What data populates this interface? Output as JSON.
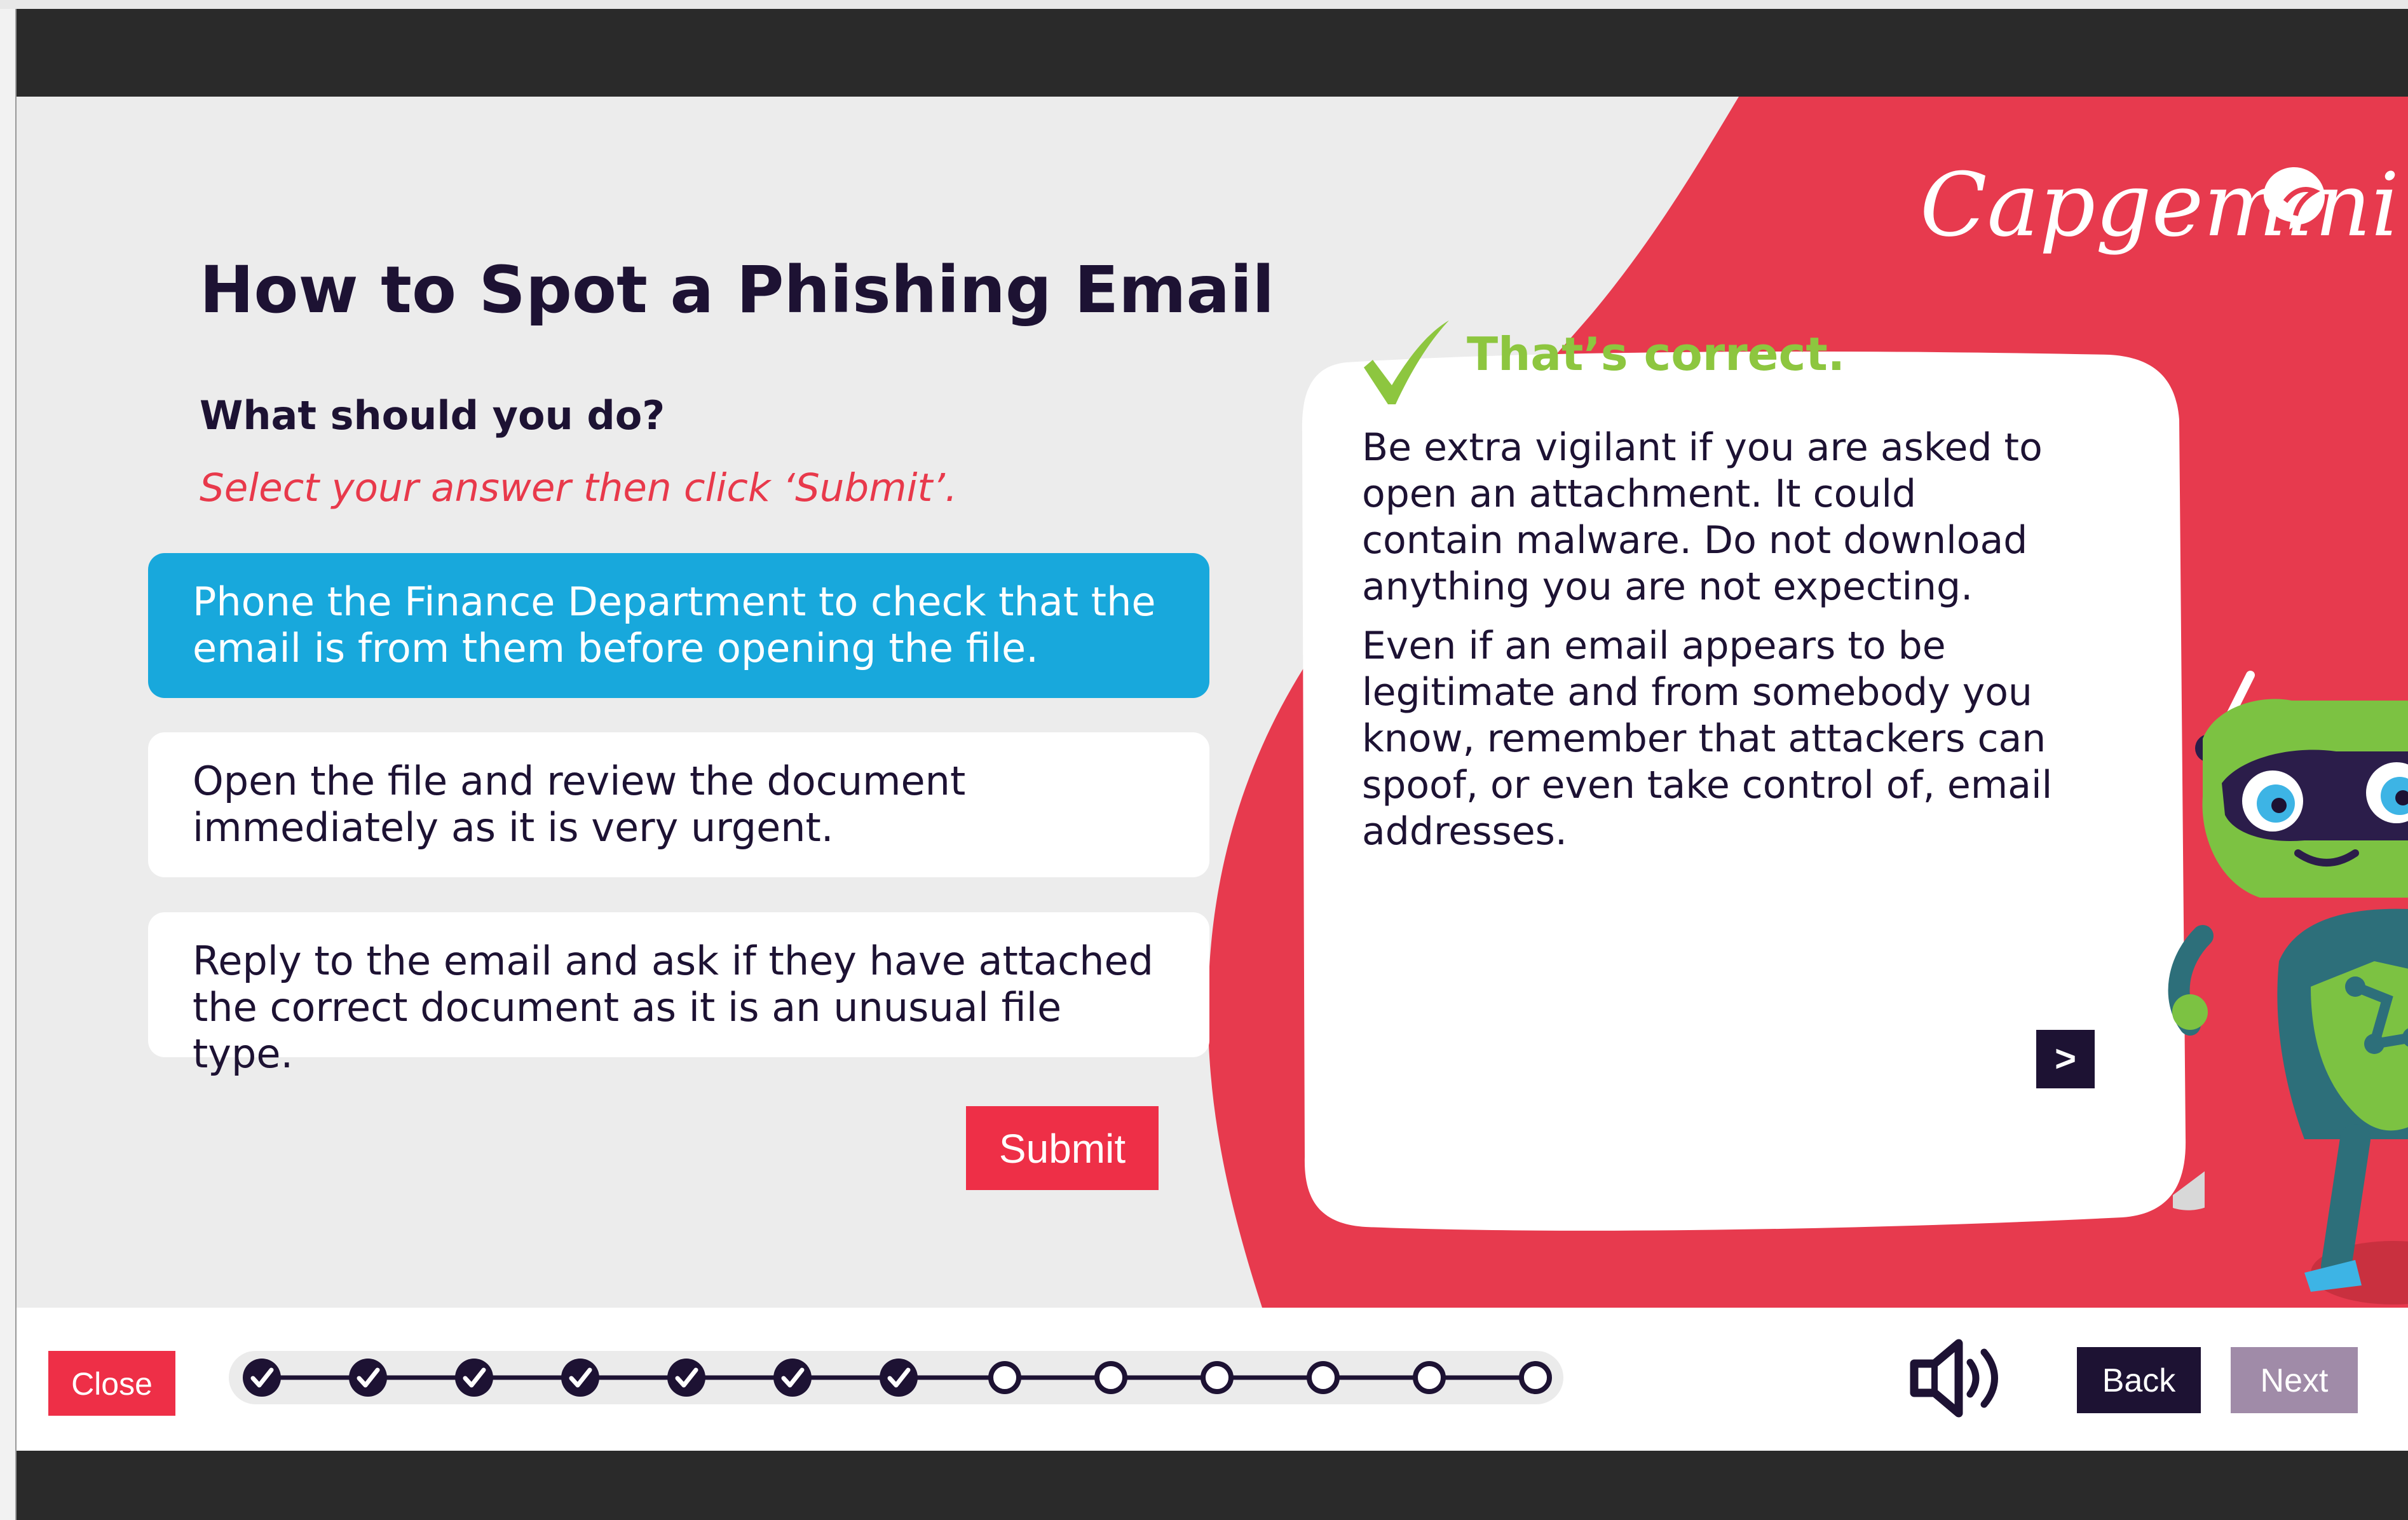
{
  "lesson": {
    "title": "How to Spot a Phishing Email",
    "question": "What should you do?",
    "instruction": "Select your answer then click ‘Submit’.",
    "options": [
      {
        "label": "Phone the Finance Department to check that the email is from them before opening the file.",
        "selected": true
      },
      {
        "label": "Open the file and review the document immediately as it is very urgent.",
        "selected": false
      },
      {
        "label": "Reply to the email and ask if they have attached the correct document as it is an unusual file type.",
        "selected": false
      }
    ],
    "submit_label": "Submit"
  },
  "brand": {
    "logo_text": "Capgemini"
  },
  "feedback": {
    "heading": "That’s correct.",
    "paragraphs": [
      "Be extra vigilant if you are asked to open an attachment. It could contain malware. Do not download anything you are not expecting.",
      "Even if an email appears to be legitimate and from somebody you know, remember that attackers can spoof, or even take control of, email addresses."
    ],
    "continue_label": ">"
  },
  "navigation": {
    "close_label": "Close",
    "back_label": "Back",
    "next_label": "Next",
    "progress": {
      "total_steps": 13,
      "completed_steps": 7
    }
  },
  "icons": {
    "check": "checkmark-icon",
    "sound": "speaker-icon",
    "logo_mark": "spade-icon",
    "progress_done": "check-circle-icon",
    "progress_todo": "empty-circle-icon"
  },
  "colors": {
    "accent_red": "#ee2f47",
    "background_red": "#e73a4e",
    "selected_blue": "#18a8dc",
    "dark_navy": "#1d1233",
    "correct_green": "#8dc63f",
    "next_disabled": "#a08ba8"
  }
}
